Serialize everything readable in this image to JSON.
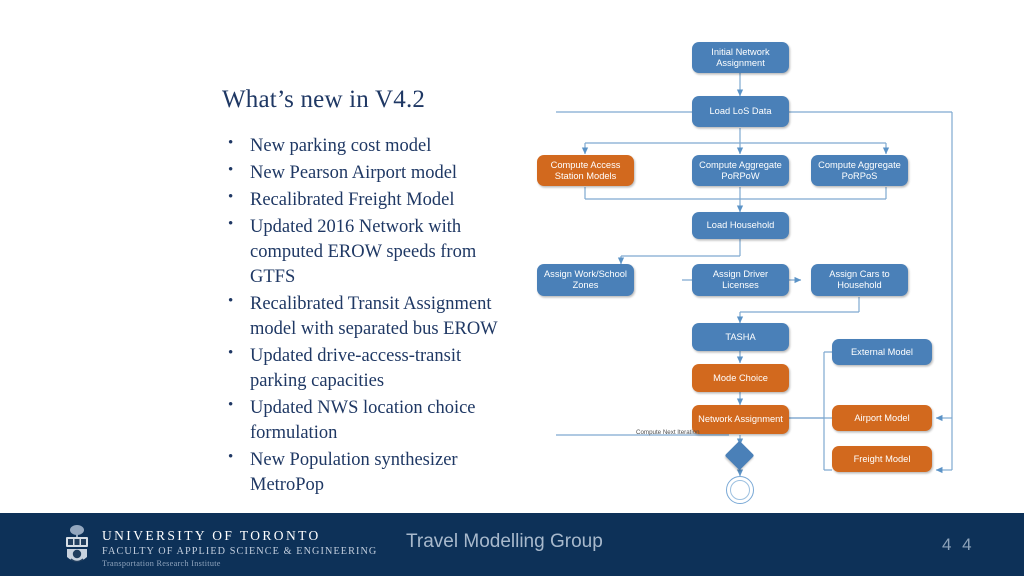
{
  "slide": {
    "title": "What’s new in V4.2",
    "bullets": [
      "New parking cost model",
      "New Pearson Airport model",
      "Recalibrated Freight Model",
      "Updated 2016 Network with computed EROW speeds from GTFS",
      "Recalibrated Transit Assignment model with separated bus EROW",
      "Updated drive-access-transit parking capacities",
      "Updated NWS location choice formulation",
      "New Population synthesizer MetroPop"
    ]
  },
  "flowchart": {
    "nodes": [
      {
        "id": "initial-network-assignment",
        "label": "Initial Network Assignment",
        "color": "blue"
      },
      {
        "id": "load-los-data",
        "label": "Load LoS Data",
        "color": "blue"
      },
      {
        "id": "compute-access-station-models",
        "label": "Compute Access Station Models",
        "color": "orange"
      },
      {
        "id": "compute-aggregate-porpow",
        "label": "Compute Aggregate PoRPoW",
        "color": "blue"
      },
      {
        "id": "compute-aggregate-porpos",
        "label": "Compute Aggregate PoRPoS",
        "color": "blue"
      },
      {
        "id": "load-household",
        "label": "Load Household",
        "color": "blue"
      },
      {
        "id": "assign-work-school-zones",
        "label": "Assign Work/School Zones",
        "color": "blue"
      },
      {
        "id": "assign-driver-licenses",
        "label": "Assign Driver Licenses",
        "color": "blue"
      },
      {
        "id": "assign-cars-to-household",
        "label": "Assign Cars to Household",
        "color": "blue"
      },
      {
        "id": "tasha",
        "label": "TASHA",
        "color": "blue"
      },
      {
        "id": "mode-choice",
        "label": "Mode Choice",
        "color": "orange"
      },
      {
        "id": "network-assignment",
        "label": "Network Assignment",
        "color": "orange"
      },
      {
        "id": "external-model",
        "label": "External Model",
        "color": "blue"
      },
      {
        "id": "airport-model",
        "label": "Airport Model",
        "color": "orange"
      },
      {
        "id": "freight-model",
        "label": "Freight Model",
        "color": "orange"
      }
    ],
    "edge_label": "Compute Next Iteration",
    "colors": {
      "blue": "#4a80b8",
      "orange": "#d2691e",
      "connector": "#7fa9d0"
    }
  },
  "footer": {
    "logo_line1": "UNIVERSITY OF TORONTO",
    "logo_line2": "FACULTY OF APPLIED SCIENCE & ENGINEERING",
    "logo_line3": "Transportation Research Institute",
    "title": "Travel Modelling Group",
    "page_number": "4 4",
    "background": "#0d3158"
  }
}
